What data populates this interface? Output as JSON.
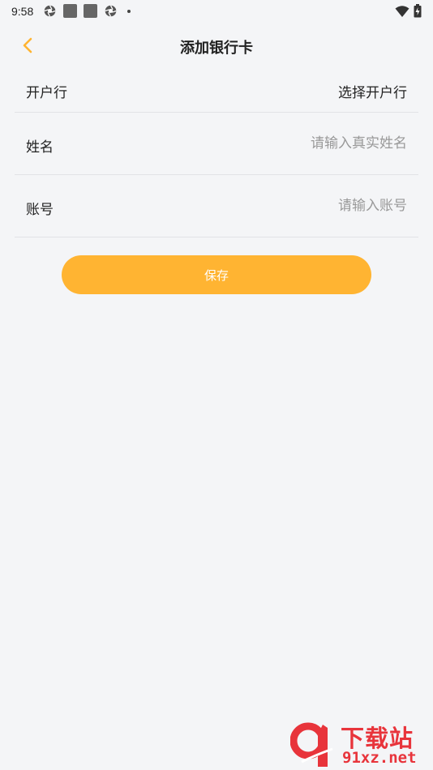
{
  "status_bar": {
    "time": "9:58",
    "left_icons": [
      "aperture-icon",
      "square-icon",
      "square-icon",
      "aperture-icon",
      "dot-icon"
    ],
    "right_icons": [
      "wifi-icon",
      "battery-charging-icon"
    ]
  },
  "header": {
    "title": "添加银行卡",
    "back_icon": "chevron-left-icon",
    "accent_color": "#ffb432"
  },
  "form": {
    "bank": {
      "label": "开户行",
      "value": "选择开户行"
    },
    "name": {
      "label": "姓名",
      "placeholder": "请输入真实姓名"
    },
    "account": {
      "label": "账号",
      "placeholder": "请输入账号"
    }
  },
  "actions": {
    "save_label": "保存"
  },
  "watermark": {
    "logo_text": "91",
    "title": "下载站",
    "url": "91xz.net",
    "color": "#e8343b"
  }
}
